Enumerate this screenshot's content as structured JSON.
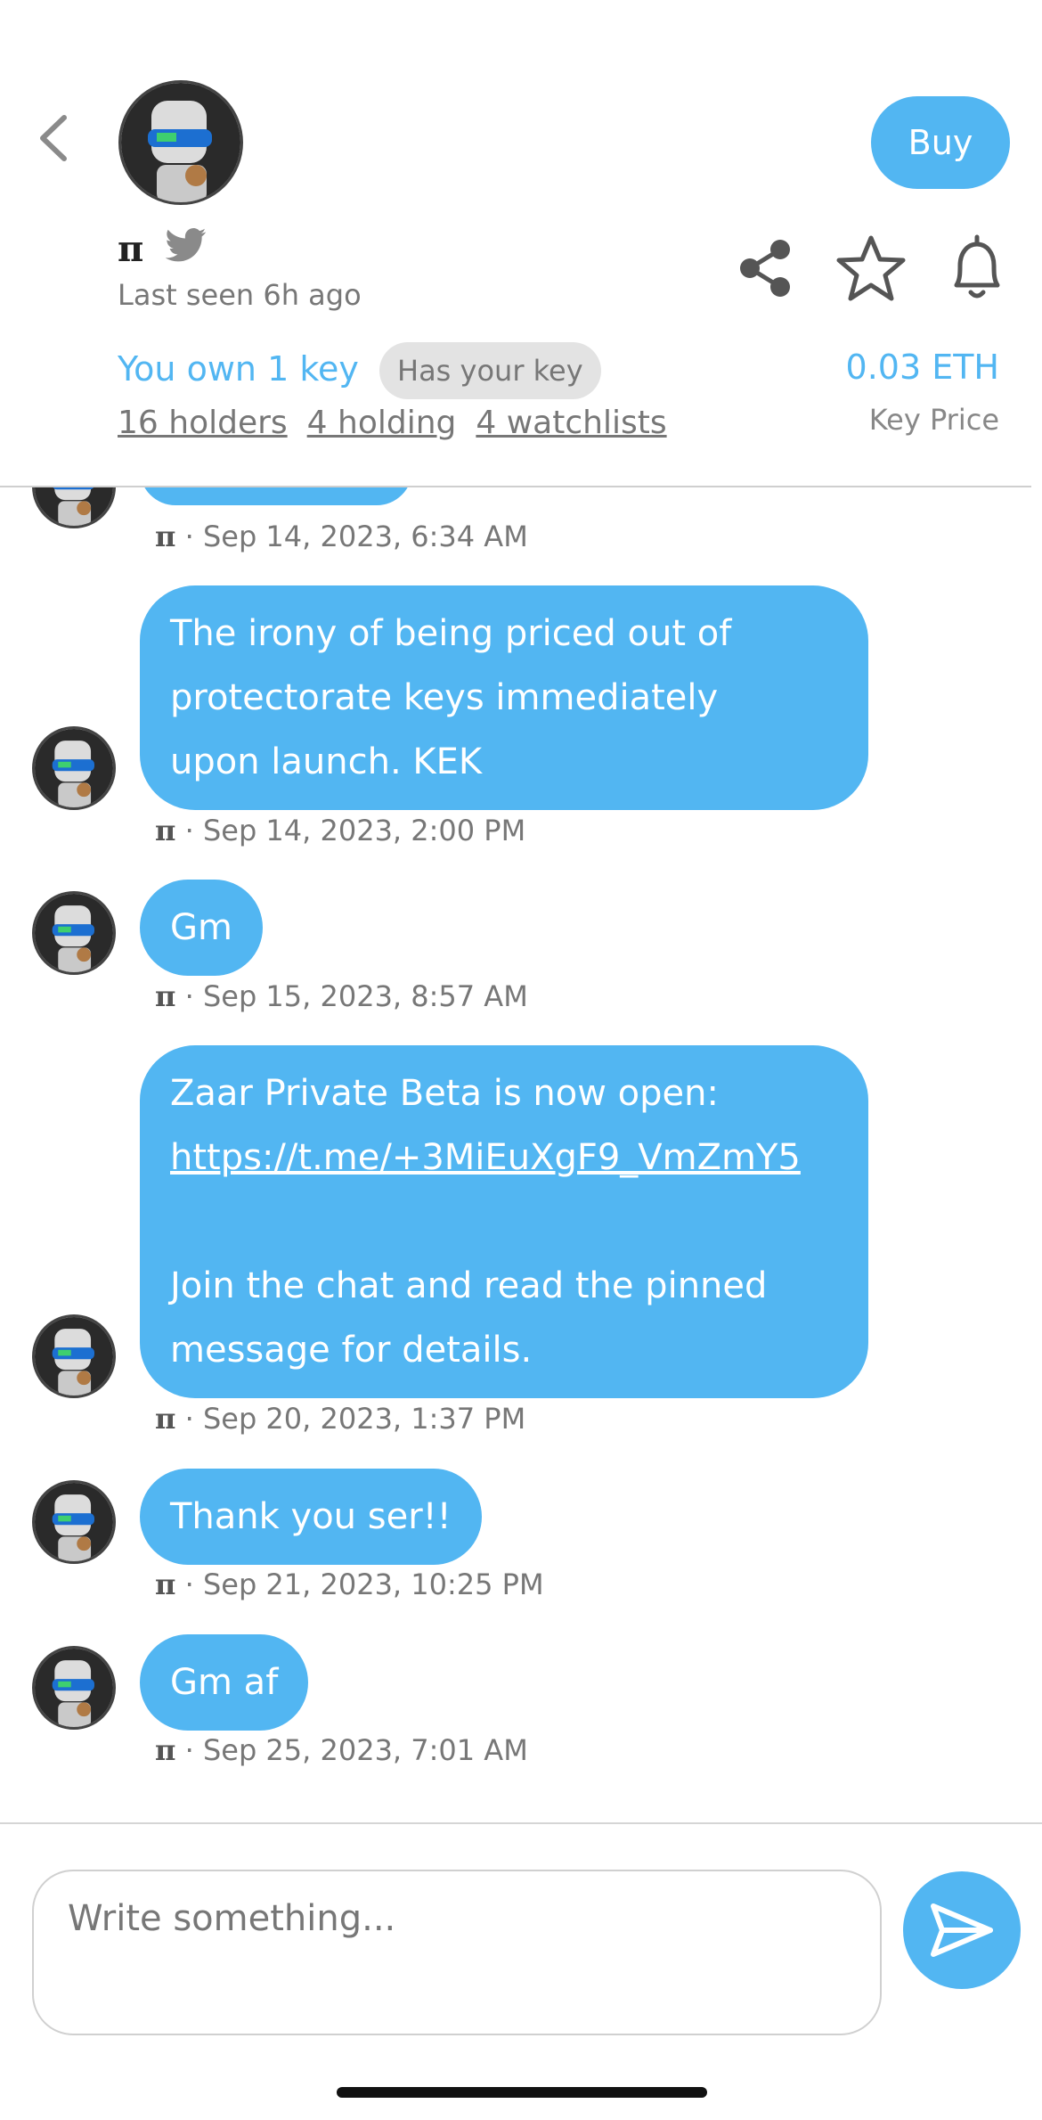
{
  "header": {
    "user_name": "π",
    "last_seen": "Last seen 6h ago",
    "buy_label": "Buy",
    "ownership": "You own 1 key",
    "has_key_badge": "Has your key",
    "holders": "16 holders",
    "holding": "4 holding",
    "watchlists": "4 watchlists",
    "key_price": "0.03 ETH",
    "key_price_label": "Key Price",
    "icons": [
      "back-chevron-icon",
      "avatar",
      "twitter-icon",
      "share-icon",
      "star-icon",
      "bell-icon"
    ]
  },
  "messages": [
    {
      "text": "",
      "author": "π",
      "time": "Sep 14, 2023, 6:34 AM"
    },
    {
      "lines": [
        "The irony of being priced out of",
        "protectorate keys immediately",
        "upon launch. KEK"
      ],
      "author": "π",
      "time": "Sep 14, 2023, 2:00 PM"
    },
    {
      "text": "Gm",
      "author": "π",
      "time": "Sep 15, 2023, 8:57 AM"
    },
    {
      "line1": "Zaar Private Beta is now open:",
      "link": "https://t.me/+3MiEuXgF9_VmZmY5",
      "line3": "Join the chat and read the pinned",
      "line4": "message for details.",
      "author": "π",
      "time": "Sep 20, 2023, 1:37 PM"
    },
    {
      "text": "Thank you ser!!",
      "author": "π",
      "time": "Sep 21, 2023, 10:25 PM"
    },
    {
      "text": "Gm af",
      "author": "π",
      "time": "Sep 25, 2023, 7:01 AM"
    }
  ],
  "composer": {
    "placeholder": "Write something...",
    "send_icon": "send-icon"
  },
  "colors": {
    "accent": "#52b6f2",
    "bubble_text": "#ffffff",
    "muted": "#777777"
  }
}
